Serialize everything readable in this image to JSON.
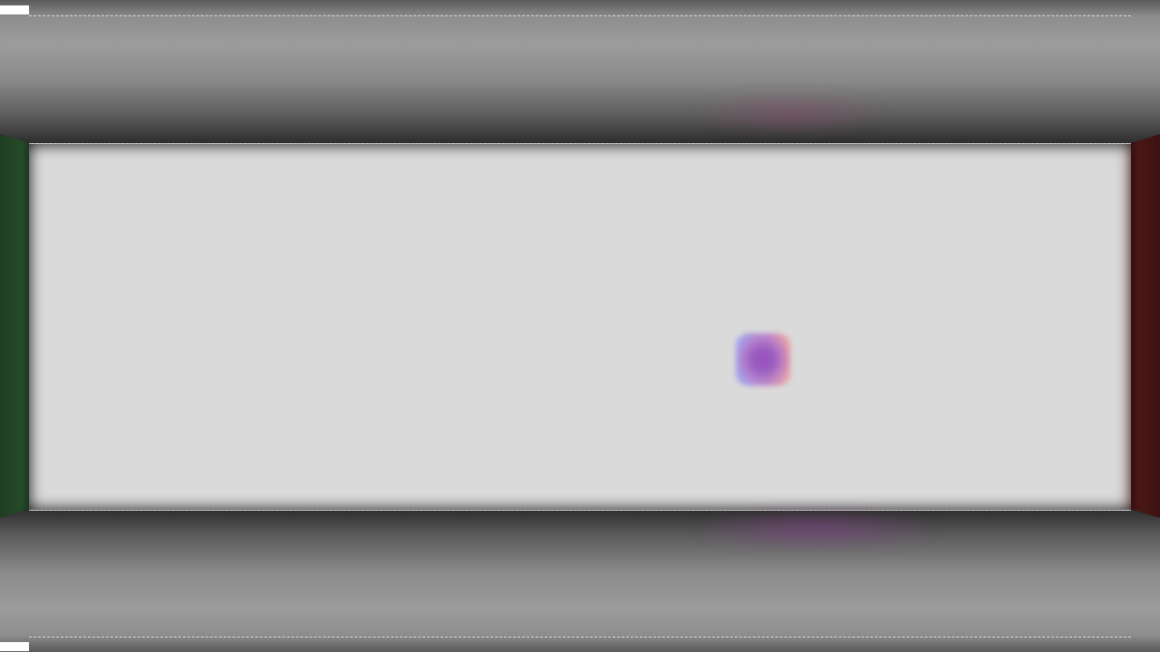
{
  "scene": {
    "colors": {
      "back_wall": "#dadada",
      "left_wall": "#254a29",
      "right_wall": "#4a1616",
      "ceiling_floor": "#9c9c9c",
      "orb": "#9a4fc0"
    },
    "icons": {
      "orb": "ball"
    }
  }
}
